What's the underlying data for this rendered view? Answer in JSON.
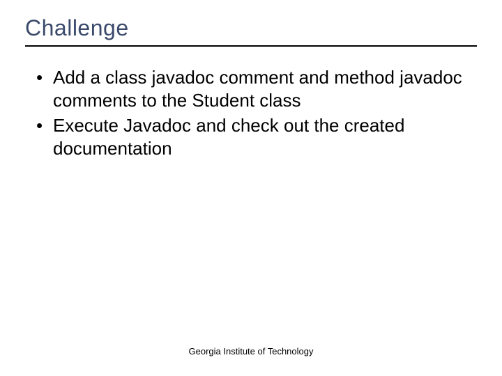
{
  "title": "Challenge",
  "bullets": [
    "Add a class javadoc comment and method javadoc comments to the Student class",
    "Execute Javadoc and check out the created documentation"
  ],
  "footer": "Georgia Institute of Technology"
}
